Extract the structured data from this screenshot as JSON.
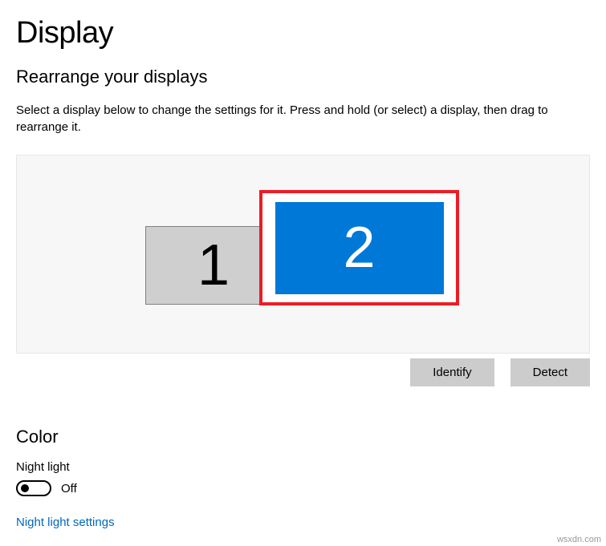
{
  "page": {
    "title": "Display"
  },
  "rearrange": {
    "heading": "Rearrange your displays",
    "help": "Select a display below to change the settings for it. Press and hold (or select) a display, then drag to rearrange it.",
    "displays": {
      "d1": "1",
      "d2": "2"
    },
    "identify_label": "Identify",
    "detect_label": "Detect"
  },
  "color": {
    "heading": "Color",
    "night_light_label": "Night light",
    "night_light_state": "Off",
    "night_light_settings_link": "Night light settings"
  },
  "watermark": "wsxdn.com"
}
